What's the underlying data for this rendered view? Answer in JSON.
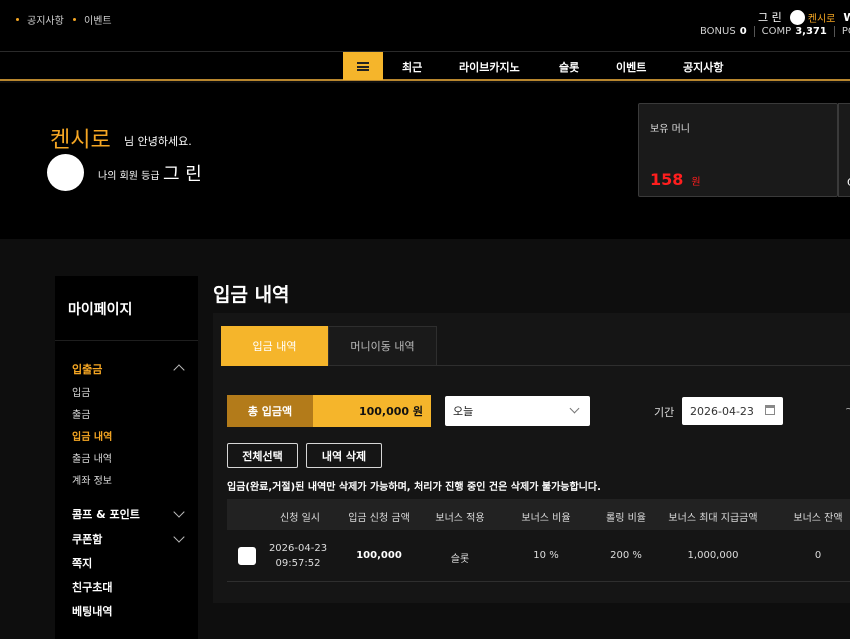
{
  "topbar": {
    "links": [
      "공지사항",
      "이벤트"
    ],
    "grade": "그 린",
    "nickname": "켄시로",
    "user_initial": "W",
    "bonus_label": "BONUS",
    "bonus_value": "0",
    "comp_label": "COMP",
    "comp_value": "3,371",
    "point_label": "POI"
  },
  "nav": {
    "items": [
      "최근",
      "라이브카지노",
      "슬롯",
      "이벤트",
      "공지사항"
    ]
  },
  "hero": {
    "name": "켄시로",
    "greeting": "님 안녕하세요.",
    "grade_label": "나의 회원 등급",
    "grade": "그 린",
    "money_label": "보유 머니",
    "money_value": "158",
    "money_unit": "원",
    "next_box_initial": "C"
  },
  "sidebar": {
    "title": "마이페이지",
    "sections": [
      {
        "label": "입출금",
        "items": [
          "입금",
          "출금",
          "입금 내역",
          "출금 내역",
          "계좌 정보"
        ]
      },
      {
        "label": "콤프 & 포인트"
      },
      {
        "label": "쿠폰함"
      },
      {
        "label": "쪽지"
      },
      {
        "label": "친구초대"
      },
      {
        "label": "베팅내역"
      }
    ]
  },
  "main": {
    "title": "입금 내역",
    "tabs": [
      "입금 내역",
      "머니이동 내역"
    ],
    "total_label": "총 입금액",
    "total_value": "100,000 원",
    "period_select": "오늘",
    "period_label": "기간",
    "date_from": "2026-04-23",
    "select_all_button": "전체선택",
    "delete_button": "내역 삭제",
    "notice": "입금(완료,거절)된 내역만 삭제가 가능하며, 처리가 진행 중인 건은 삭제가 불가능합니다.",
    "table": {
      "headers": [
        "신청 일시",
        "입금 신청 금액",
        "보너스 적용",
        "보너스 비율",
        "롤링 비율",
        "보너스 최대 지급금액",
        "보너스 잔액"
      ],
      "rows": [
        {
          "date": "2026-04-23",
          "time": "09:57:52",
          "amount": "100,000",
          "bonus_type": "슬롯",
          "bonus_rate": "10 %",
          "rolling_rate": "200 %",
          "bonus_max": "1,000,000",
          "bonus_balance": "0"
        }
      ]
    }
  }
}
